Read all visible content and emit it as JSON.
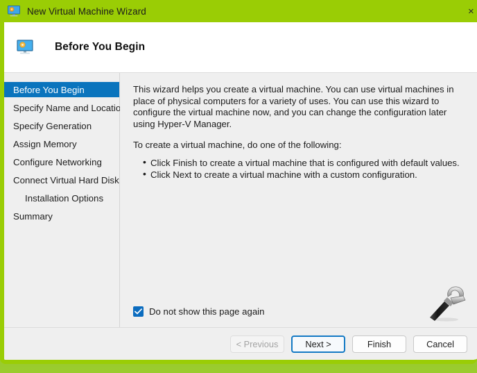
{
  "window": {
    "title": "New Virtual Machine Wizard",
    "icon": "vm-monitor-gear-icon",
    "close_label": "×"
  },
  "header": {
    "title": "Before You Begin",
    "icon": "vm-monitor-gear-icon"
  },
  "sidebar": {
    "items": [
      {
        "label": "Before You Begin",
        "selected": true,
        "indented": false
      },
      {
        "label": "Specify Name and Location",
        "selected": false,
        "indented": false
      },
      {
        "label": "Specify Generation",
        "selected": false,
        "indented": false
      },
      {
        "label": "Assign Memory",
        "selected": false,
        "indented": false
      },
      {
        "label": "Configure Networking",
        "selected": false,
        "indented": false
      },
      {
        "label": "Connect Virtual Hard Disk",
        "selected": false,
        "indented": false
      },
      {
        "label": "Installation Options",
        "selected": false,
        "indented": true
      },
      {
        "label": "Summary",
        "selected": false,
        "indented": false
      }
    ]
  },
  "main": {
    "intro_paragraph": "This wizard helps you create a virtual machine. You can use virtual machines in place of physical computers for a variety of uses. You can use this wizard to configure the virtual machine now, and you can change the configuration later using Hyper-V Manager.",
    "instruction_paragraph": "To create a virtual machine, do one of the following:",
    "bullets": [
      "Click Finish to create a virtual machine that is configured with default values.",
      "Click Next to create a virtual machine with a custom configuration."
    ],
    "checkbox": {
      "label": "Do not show this page again",
      "checked": true
    },
    "decoration_icon": "hammer-icon"
  },
  "footer": {
    "buttons": [
      {
        "label": "< Previous",
        "state": "disabled"
      },
      {
        "label": "Next >",
        "state": "default"
      },
      {
        "label": "Finish",
        "state": "normal"
      },
      {
        "label": "Cancel",
        "state": "normal"
      }
    ]
  },
  "colors": {
    "title_bar": "#9acd05",
    "accent_selection": "#0a74bd",
    "checkbox_fill": "#0b6cbf",
    "default_button_border": "#1379c4",
    "panel_background": "#efefef",
    "desktop_background": "#6aa424"
  }
}
